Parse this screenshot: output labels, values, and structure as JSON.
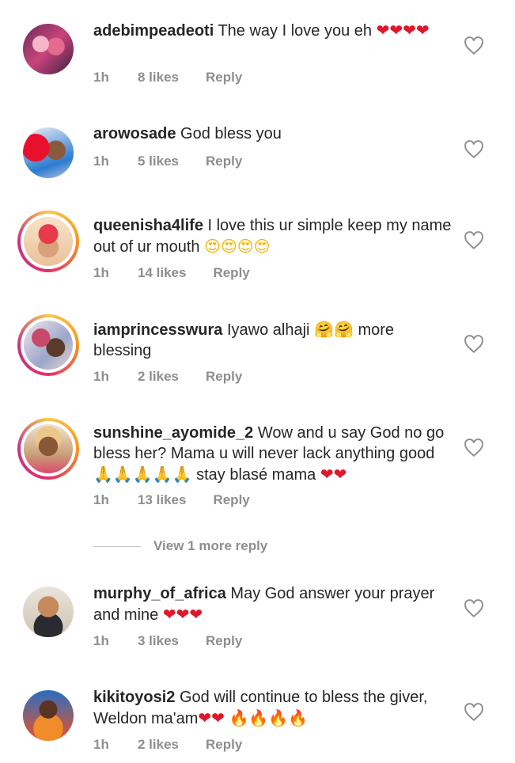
{
  "comments": [
    {
      "username": "adebimpeadeoti",
      "text": "The way I love you eh",
      "emoji": "❤❤❤❤",
      "time": "1h",
      "likes": "8 likes",
      "reply": "Reply"
    },
    {
      "username": "arowosade",
      "text": "God bless you",
      "emoji": "",
      "time": "1h",
      "likes": "5 likes",
      "reply": "Reply"
    },
    {
      "username": "queenisha4life",
      "text": "I love this ur simple keep my name out of ur mouth",
      "emoji": "😍😍😍😍",
      "time": "1h",
      "likes": "14 likes",
      "reply": "Reply"
    },
    {
      "username": "iamprincesswura",
      "text": "Iyawo alhaji",
      "emoji": "🤗🤗",
      "text_after": "more blessing",
      "time": "1h",
      "likes": "2 likes",
      "reply": "Reply"
    },
    {
      "username": "sunshine_ayomide_2",
      "text": "Wow and u say God no go bless her? Mama u will never lack anything good",
      "emoji": "🙏🙏🙏🙏🙏",
      "text_after": "stay blasé mama",
      "emoji_after": "❤❤",
      "time": "1h",
      "likes": "13 likes",
      "reply": "Reply"
    },
    {
      "username": "murphy_of_africa",
      "text": "May God answer your prayer and mine",
      "emoji": "❤❤❤",
      "time": "1h",
      "likes": "3 likes",
      "reply": "Reply"
    },
    {
      "username": "kikitoyosi2",
      "text": "God will continue to bless the giver, Weldon ma'am",
      "emoji": "❤❤",
      "emoji_after": "🔥🔥🔥🔥",
      "time": "1h",
      "likes": "2 likes",
      "reply": "Reply"
    }
  ],
  "view_more_replies": "View 1 more reply",
  "colors": {
    "text": "#262626",
    "meta": "#8e8e8e",
    "heart_red": "#e0162b"
  },
  "icons": {
    "like": "heart-outline-icon"
  }
}
